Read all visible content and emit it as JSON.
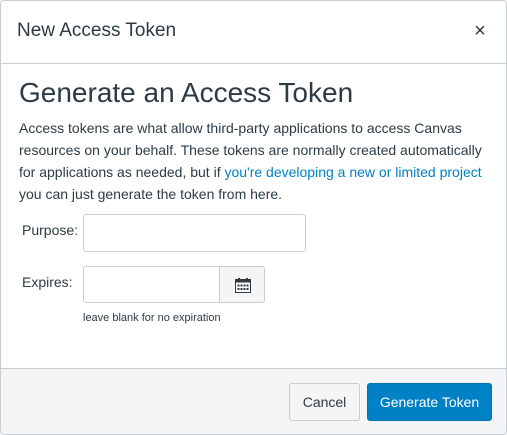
{
  "dialog": {
    "title": "New Access Token",
    "close_icon": "close-icon",
    "close_glyph": "×"
  },
  "content": {
    "heading": "Generate an Access Token",
    "intro_before_link": "Access tokens are what allow third-party applications to access Canvas resources on your behalf. These tokens are normally created automatically for applications as needed, but if ",
    "intro_link": "you're developing a new or limited project",
    "intro_after_link": " you can just generate the token from here."
  },
  "form": {
    "purpose_label": "Purpose:",
    "purpose_value": "",
    "expires_label": "Expires:",
    "expires_value": "",
    "date_picker_icon": "calendar-icon",
    "expires_hint": "leave blank for no expiration"
  },
  "footer": {
    "cancel_label": "Cancel",
    "submit_label": "Generate Token"
  },
  "colors": {
    "primary": "#0081c6",
    "text": "#2d3b45",
    "border": "#c7cdd1",
    "footer_bg": "#f5f5f5"
  }
}
